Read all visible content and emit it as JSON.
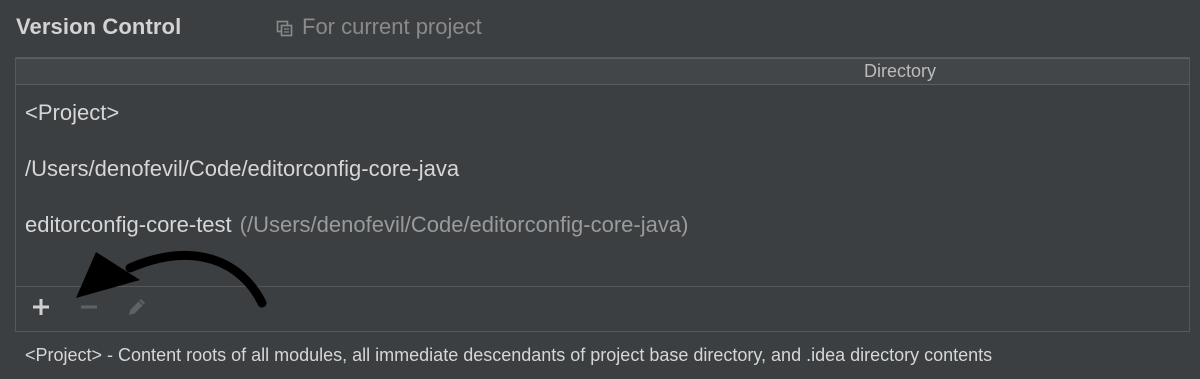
{
  "section": {
    "title": "Version Control",
    "scope_label": "For current project",
    "scope_icon": "copy-icon"
  },
  "table": {
    "columns": [
      "",
      "Directory"
    ],
    "rows": [
      {
        "primary": "<Project>",
        "secondary": ""
      },
      {
        "primary": "/Users/denofevil/Code/editorconfig-core-java",
        "secondary": ""
      },
      {
        "primary": "editorconfig-core-test",
        "secondary": "(/Users/denofevil/Code/editorconfig-core-java)"
      }
    ]
  },
  "toolbar": {
    "buttons": [
      {
        "name": "add-button",
        "icon": "plus-icon",
        "enabled": true
      },
      {
        "name": "remove-button",
        "icon": "minus-icon",
        "enabled": false
      },
      {
        "name": "edit-button",
        "icon": "pencil-icon",
        "enabled": false
      }
    ]
  },
  "footer_text": "<Project> - Content roots of all modules, all immediate descendants of project base directory, and .idea directory contents",
  "colors": {
    "background": "#3c3f41",
    "header_bg": "#434648",
    "text": "#d6d6d6",
    "muted_text": "#9a9a9a",
    "disabled_icon": "#5f6264",
    "annotation_arrow": "#000000"
  }
}
